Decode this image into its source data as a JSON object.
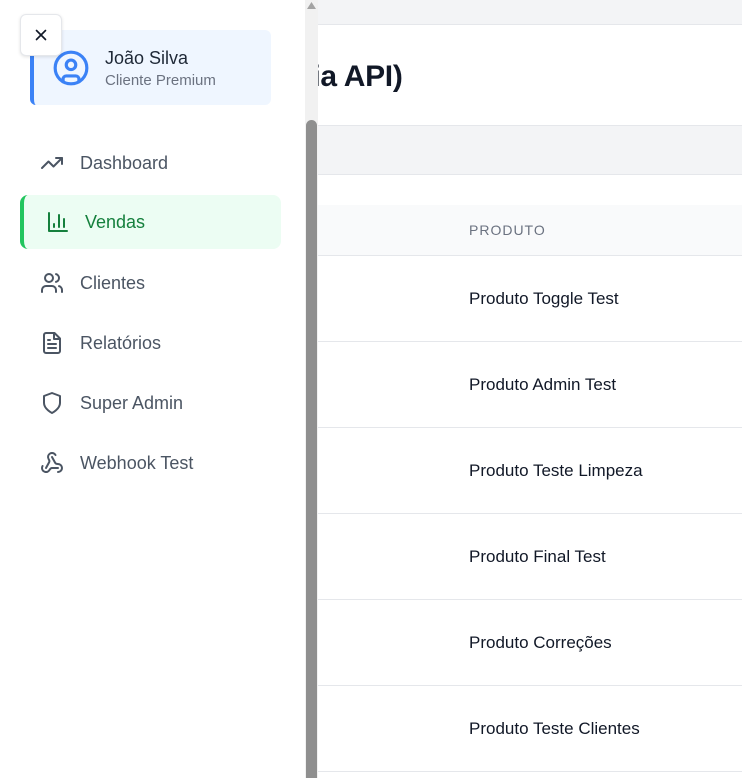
{
  "page": {
    "title_visible": "via API)",
    "table": {
      "header_produto": "PRODUTO",
      "rows": [
        {
          "produto": "Produto Toggle Test"
        },
        {
          "produto": "Produto Admin Test"
        },
        {
          "produto": "Produto Teste Limpeza"
        },
        {
          "produto": "Produto Final Test"
        },
        {
          "produto": "Produto Correções"
        },
        {
          "produto": "Produto Teste Clientes"
        }
      ]
    }
  },
  "sidebar": {
    "close_icon": "close-icon",
    "profile": {
      "name": "João Silva",
      "role": "Cliente Premium",
      "icon": "user-circle-icon"
    },
    "items": [
      {
        "label": "Dashboard",
        "icon": "trending-up-icon",
        "active": false
      },
      {
        "label": "Vendas",
        "icon": "bar-chart-icon",
        "active": true
      },
      {
        "label": "Clientes",
        "icon": "users-icon",
        "active": false
      },
      {
        "label": "Relatórios",
        "icon": "file-text-icon",
        "active": false
      },
      {
        "label": "Super Admin",
        "icon": "shield-icon",
        "active": false
      },
      {
        "label": "Webhook Test",
        "icon": "webhook-icon",
        "active": false
      }
    ]
  },
  "colors": {
    "accent_blue": "#3b82f6",
    "active_green": "#22c55e",
    "active_text": "#15803d"
  }
}
